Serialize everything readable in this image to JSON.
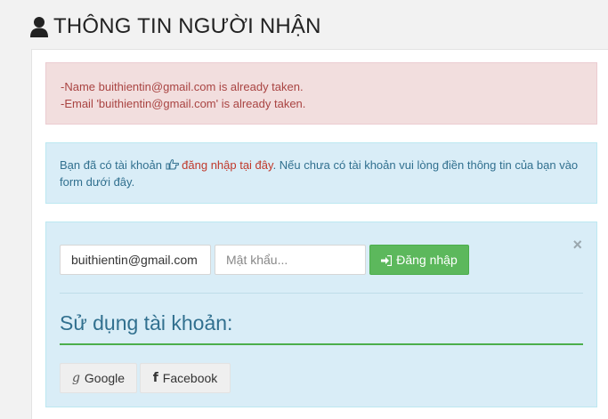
{
  "header": {
    "title": "THÔNG TIN NGƯỜI NHẬN",
    "icon": "user-icon"
  },
  "errors": [
    "-Name buithientin@gmail.com is already taken.",
    "-Email 'buithientin@gmail.com' is already taken."
  ],
  "info": {
    "text_before": "Bạn đã có tài khoản ",
    "icon": "hand-point-right-icon",
    "link": "đăng nhập tại đây",
    "text_after": ". Nếu chưa có tài khoản vui lòng điền thông tin của bạn vào form dưới đây."
  },
  "login": {
    "close_label": "×",
    "email_value": "buithientin@gmail.com",
    "password_placeholder": "Mật khẩu...",
    "button_label": "Đăng nhập",
    "button_icon": "sign-in-icon",
    "section_title": "Sử dụng tài khoản:",
    "google_glyph": "g",
    "google_label": "Google",
    "facebook_glyph": "f",
    "facebook_label": "Facebook"
  },
  "colors": {
    "danger_text": "#a94442",
    "info_text": "#31708f",
    "link": "#c0392b",
    "success": "#5cb85c"
  }
}
